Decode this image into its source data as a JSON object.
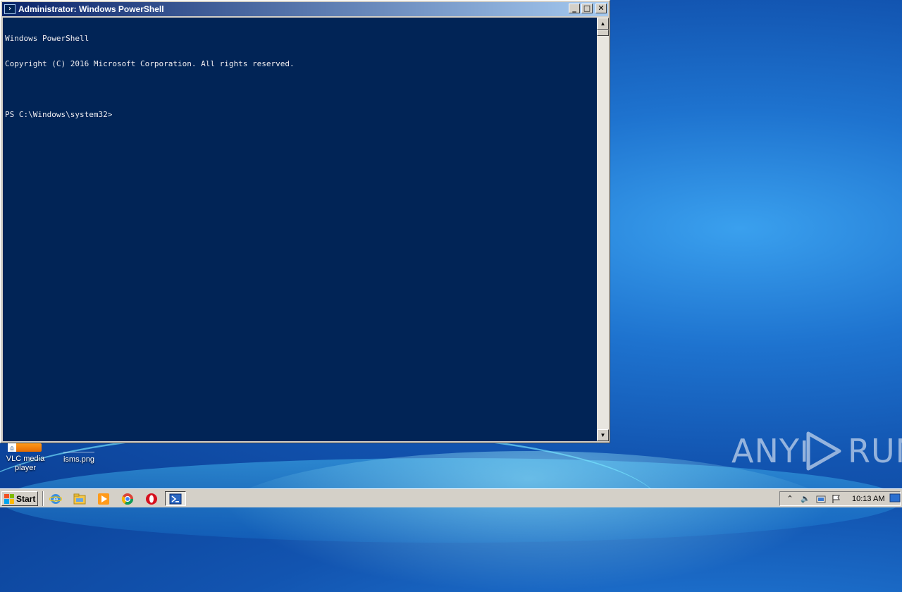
{
  "window": {
    "title": "Administrator: Windows PowerShell",
    "controls": {
      "minimize": "_",
      "maximize": "□",
      "close": "✕"
    }
  },
  "console": {
    "lines": [
      "Windows PowerShell",
      "Copyright (C) 2016 Microsoft Corporation. All rights reserved.",
      "",
      "PS C:\\Windows\\system32>"
    ]
  },
  "desktop": {
    "icons": [
      {
        "label_line1": "VLC media",
        "label_line2": "player",
        "icon": "vlc-icon"
      },
      {
        "label": "isms.png",
        "icon": "image-file-icon"
      }
    ],
    "watermark": {
      "left": "ANY",
      "right": "RUN"
    }
  },
  "taskbar": {
    "start_label": "Start",
    "pinned": [
      {
        "name": "internet-explorer-icon"
      },
      {
        "name": "file-explorer-icon"
      },
      {
        "name": "media-player-icon"
      },
      {
        "name": "chrome-icon"
      },
      {
        "name": "opera-icon"
      },
      {
        "name": "powershell-icon",
        "active": true
      }
    ],
    "tray": {
      "clock": "10:13 AM"
    }
  },
  "colors": {
    "console_bg": "#012456",
    "console_fg": "#eeedf0",
    "titlebar_start": "#0a246a",
    "titlebar_end": "#a6caf0"
  }
}
